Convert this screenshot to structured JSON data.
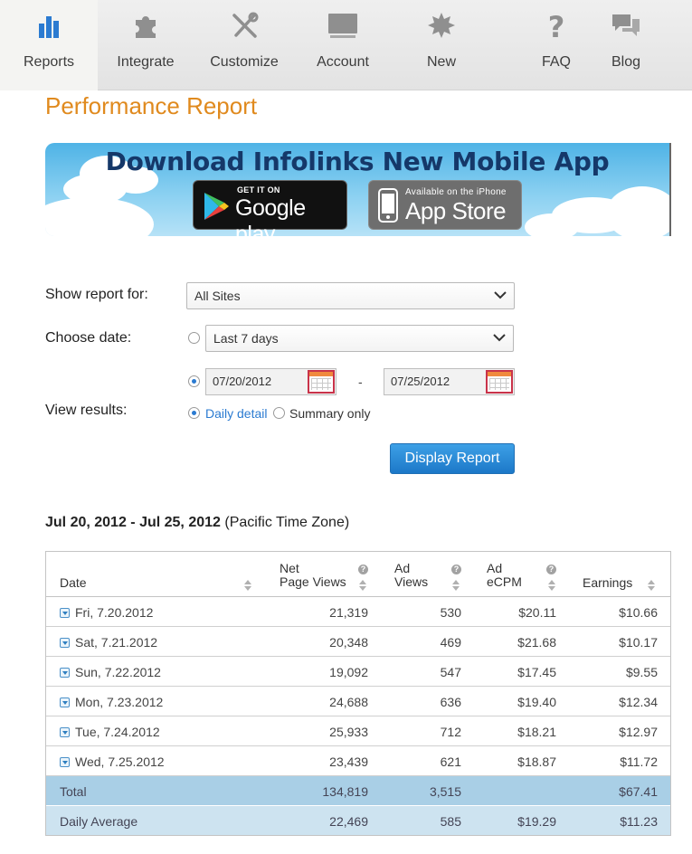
{
  "nav": {
    "items": [
      {
        "label": "Reports",
        "icon": "bar-chart-icon",
        "active": true
      },
      {
        "label": "Integrate",
        "icon": "puzzle-icon"
      },
      {
        "label": "Customize",
        "icon": "tools-icon"
      },
      {
        "label": "Account",
        "icon": "monitor-icon"
      },
      {
        "label": "New",
        "icon": "starburst-icon"
      },
      {
        "label": "FAQ",
        "icon": "question-icon"
      },
      {
        "label": "Blog",
        "icon": "speech-bubbles-icon"
      }
    ]
  },
  "page": {
    "title": "Performance Report"
  },
  "banner": {
    "headline": "Download Infolinks New Mobile App",
    "google_small": "GET IT ON",
    "google_big": "Google play",
    "apple_small": "Available on the iPhone",
    "apple_big": "App Store"
  },
  "form": {
    "site_label": "Show report for:",
    "site_value": "All Sites",
    "date_label": "Choose date:",
    "date_preset": "Last 7 days",
    "date_from": "07/20/2012",
    "date_sep": "-",
    "date_to": "07/25/2012",
    "view_label": "View results:",
    "opt_daily": "Daily detail",
    "opt_summary": "Summary only",
    "submit": "Display Report"
  },
  "range": {
    "dates": "Jul 20, 2012 - Jul 25, 2012",
    "tz": "(Pacific Time Zone)"
  },
  "table": {
    "headers": {
      "date": "Date",
      "npv_1": "Net",
      "npv_2": "Page Views",
      "adv_1": "Ad",
      "adv_2": "Views",
      "ecpm_1": "Ad",
      "ecpm_2": "eCPM",
      "earn": "Earnings"
    },
    "rows": [
      {
        "date": "Fri, 7.20.2012",
        "npv": "21,319",
        "adv": "530",
        "ecpm": "$20.11",
        "earn": "$10.66"
      },
      {
        "date": "Sat, 7.21.2012",
        "npv": "20,348",
        "adv": "469",
        "ecpm": "$21.68",
        "earn": "$10.17"
      },
      {
        "date": "Sun, 7.22.2012",
        "npv": "19,092",
        "adv": "547",
        "ecpm": "$17.45",
        "earn": "$9.55"
      },
      {
        "date": "Mon, 7.23.2012",
        "npv": "24,688",
        "adv": "636",
        "ecpm": "$19.40",
        "earn": "$12.34"
      },
      {
        "date": "Tue, 7.24.2012",
        "npv": "25,933",
        "adv": "712",
        "ecpm": "$18.21",
        "earn": "$12.97"
      },
      {
        "date": "Wed, 7.25.2012",
        "npv": "23,439",
        "adv": "621",
        "ecpm": "$18.87",
        "earn": "$11.72"
      }
    ],
    "total": {
      "label": "Total",
      "npv": "134,819",
      "adv": "3,515",
      "ecpm": "",
      "earn": "$67.41"
    },
    "average": {
      "label": "Daily Average",
      "npv": "22,469",
      "adv": "585",
      "ecpm": "$19.29",
      "earn": "$11.23"
    }
  },
  "colors": {
    "title_orange": "#e08a1e",
    "nav_icon_blue": "#2b7bd1",
    "nav_icon_gray": "#8f8f8f",
    "button_blue": "#1c78c8",
    "total_row": "#a9cfe6",
    "avg_row": "#cde3f0"
  }
}
